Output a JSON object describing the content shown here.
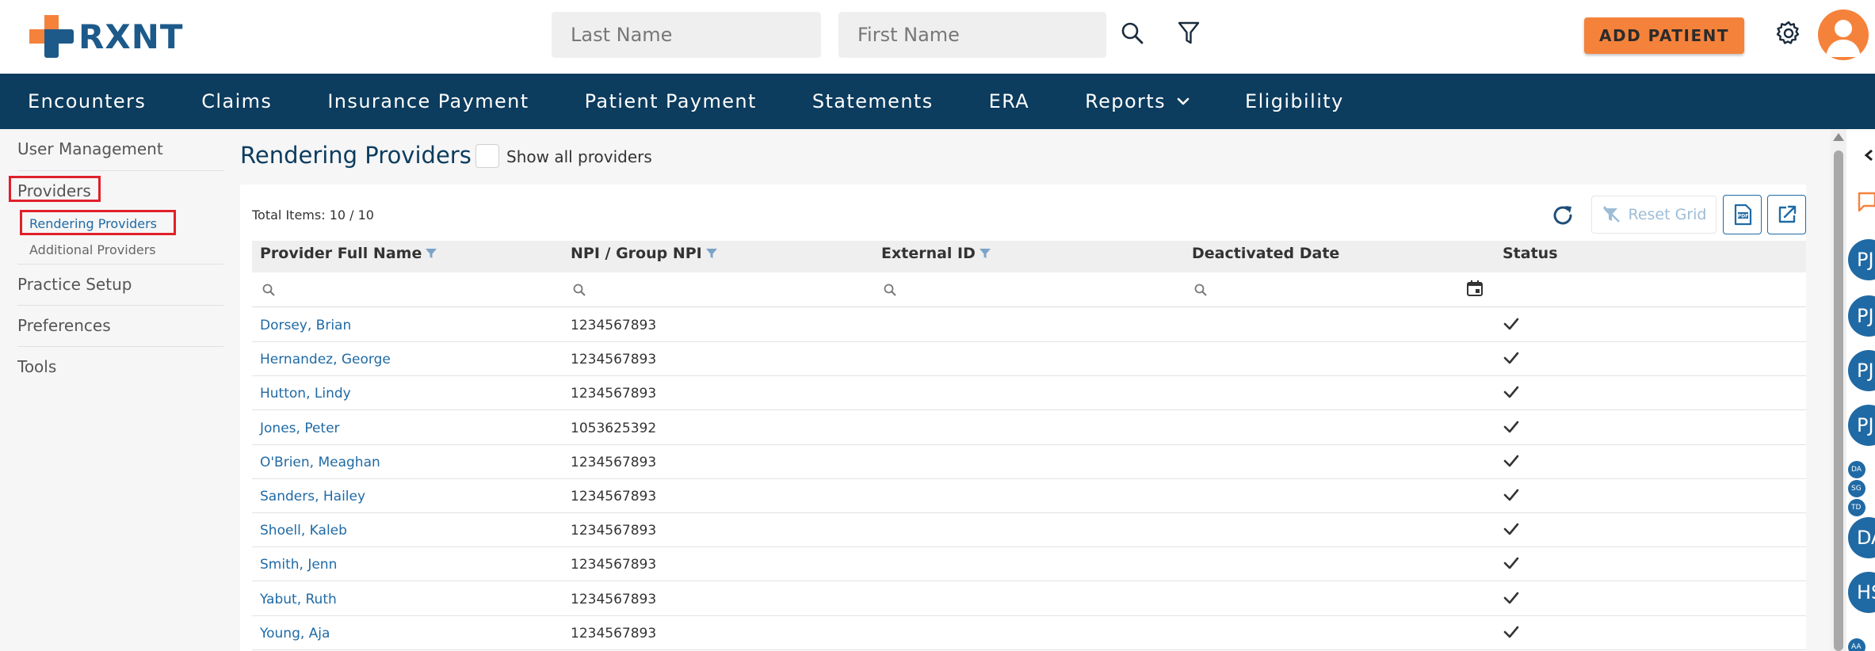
{
  "brand": {
    "name": "RXNT",
    "logo_orange": "#f5823b",
    "logo_blue": "#1d5a8a"
  },
  "header": {
    "last_name_placeholder": "Last Name",
    "first_name_placeholder": "First Name",
    "add_patient_label": "ADD PATIENT",
    "accent_color": "#f5823b"
  },
  "nav": {
    "bg_color": "#0c3c5e",
    "items": [
      {
        "label": "Encounters"
      },
      {
        "label": "Claims"
      },
      {
        "label": "Insurance Payment"
      },
      {
        "label": "Patient Payment"
      },
      {
        "label": "Statements"
      },
      {
        "label": "ERA"
      },
      {
        "label": "Reports",
        "has_dropdown": true
      },
      {
        "label": "Eligibility"
      }
    ]
  },
  "sidebar": {
    "items": [
      {
        "label": "User Management"
      },
      {
        "label": "Providers",
        "highlighted": true
      },
      {
        "label": "Practice Setup"
      },
      {
        "label": "Preferences"
      },
      {
        "label": "Tools"
      }
    ],
    "sub_items": [
      {
        "label": "Rendering Providers",
        "active": true
      },
      {
        "label": "Additional Providers"
      }
    ]
  },
  "page": {
    "title": "Rendering Providers",
    "show_all_label": "Show all providers",
    "total_items": "Total Items: 10 / 10",
    "reset_grid_label": "Reset Grid"
  },
  "grid": {
    "columns": [
      {
        "label": "Provider Full Name",
        "filterable": true
      },
      {
        "label": "NPI / Group NPI",
        "filterable": true
      },
      {
        "label": "External ID",
        "filterable": true
      },
      {
        "label": "Deactivated Date",
        "filterable": false
      },
      {
        "label": "Status",
        "filterable": false
      }
    ],
    "rows": [
      {
        "name": "Dorsey, Brian",
        "npi": "1234567893",
        "external_id": "",
        "deactivated": "",
        "active": true
      },
      {
        "name": "Hernandez, George",
        "npi": "1234567893",
        "external_id": "",
        "deactivated": "",
        "active": true
      },
      {
        "name": "Hutton, Lindy",
        "npi": "1234567893",
        "external_id": "",
        "deactivated": "",
        "active": true
      },
      {
        "name": "Jones, Peter",
        "npi": "1053625392",
        "external_id": "",
        "deactivated": "",
        "active": true
      },
      {
        "name": "O'Brien, Meaghan",
        "npi": "1234567893",
        "external_id": "",
        "deactivated": "",
        "active": true
      },
      {
        "name": "Sanders, Hailey",
        "npi": "1234567893",
        "external_id": "",
        "deactivated": "",
        "active": true
      },
      {
        "name": "Shoell, Kaleb",
        "npi": "1234567893",
        "external_id": "",
        "deactivated": "",
        "active": true
      },
      {
        "name": "Smith, Jenn",
        "npi": "1234567893",
        "external_id": "",
        "deactivated": "",
        "active": true
      },
      {
        "name": "Yabut, Ruth",
        "npi": "1234567893",
        "external_id": "",
        "deactivated": "",
        "active": true
      },
      {
        "name": "Young, Aja",
        "npi": "1234567893",
        "external_id": "",
        "deactivated": "",
        "active": true
      }
    ]
  },
  "right_rail": {
    "bubbles": [
      "PJ",
      "PJ",
      "PJ",
      "PJ",
      "DA",
      "SG",
      "TD",
      "DA",
      "HS",
      "AA"
    ]
  }
}
